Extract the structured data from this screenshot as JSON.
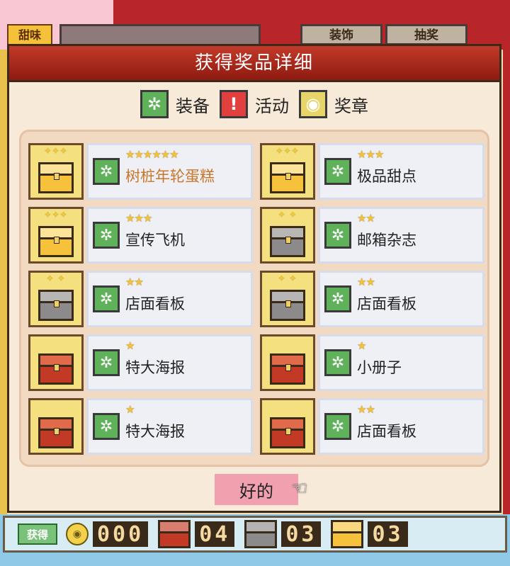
{
  "background": {
    "left_tab": "甜味",
    "tabs": [
      "装饰",
      "抽奖"
    ]
  },
  "dialog": {
    "title": "获得奖品详细",
    "legend": [
      {
        "icon": "gear-icon",
        "label": "装备"
      },
      {
        "icon": "exclamation-icon",
        "label": "活动"
      },
      {
        "icon": "medal-icon",
        "label": "奖章"
      }
    ],
    "prizes": [
      {
        "chest": "gold",
        "stars": "★★★★★★",
        "name": "树桩年轮蛋糕",
        "special": true
      },
      {
        "chest": "gold",
        "stars": "★★★",
        "name": "极品甜点",
        "special": false
      },
      {
        "chest": "gold",
        "stars": "★★★",
        "name": "宣传飞机",
        "special": false
      },
      {
        "chest": "silver",
        "stars": "★★",
        "name": "邮箱杂志",
        "special": false
      },
      {
        "chest": "silver",
        "stars": "★★",
        "name": "店面看板",
        "special": false
      },
      {
        "chest": "silver",
        "stars": "★★",
        "name": "店面看板",
        "special": false
      },
      {
        "chest": "red",
        "stars": "★",
        "name": "特大海报",
        "special": false
      },
      {
        "chest": "red",
        "stars": "★",
        "name": "小册子",
        "special": false
      },
      {
        "chest": "red",
        "stars": "★",
        "name": "特大海报",
        "special": false
      },
      {
        "chest": "red",
        "stars": "★★",
        "name": "店面看板",
        "special": false
      }
    ],
    "ok_label": "好的"
  },
  "bottom_bar": {
    "label": "获得",
    "coin_count": "000",
    "red_chest_count": "04",
    "silver_chest_count": "03",
    "gold_chest_count": "03"
  },
  "colors": {
    "title_red": "#b8262a",
    "gear_green": "#5fb15a",
    "event_red": "#e2403f",
    "medal_gold": "#e8d56a",
    "special_text": "#c8772a",
    "ok_button": "#f0a0ae"
  }
}
